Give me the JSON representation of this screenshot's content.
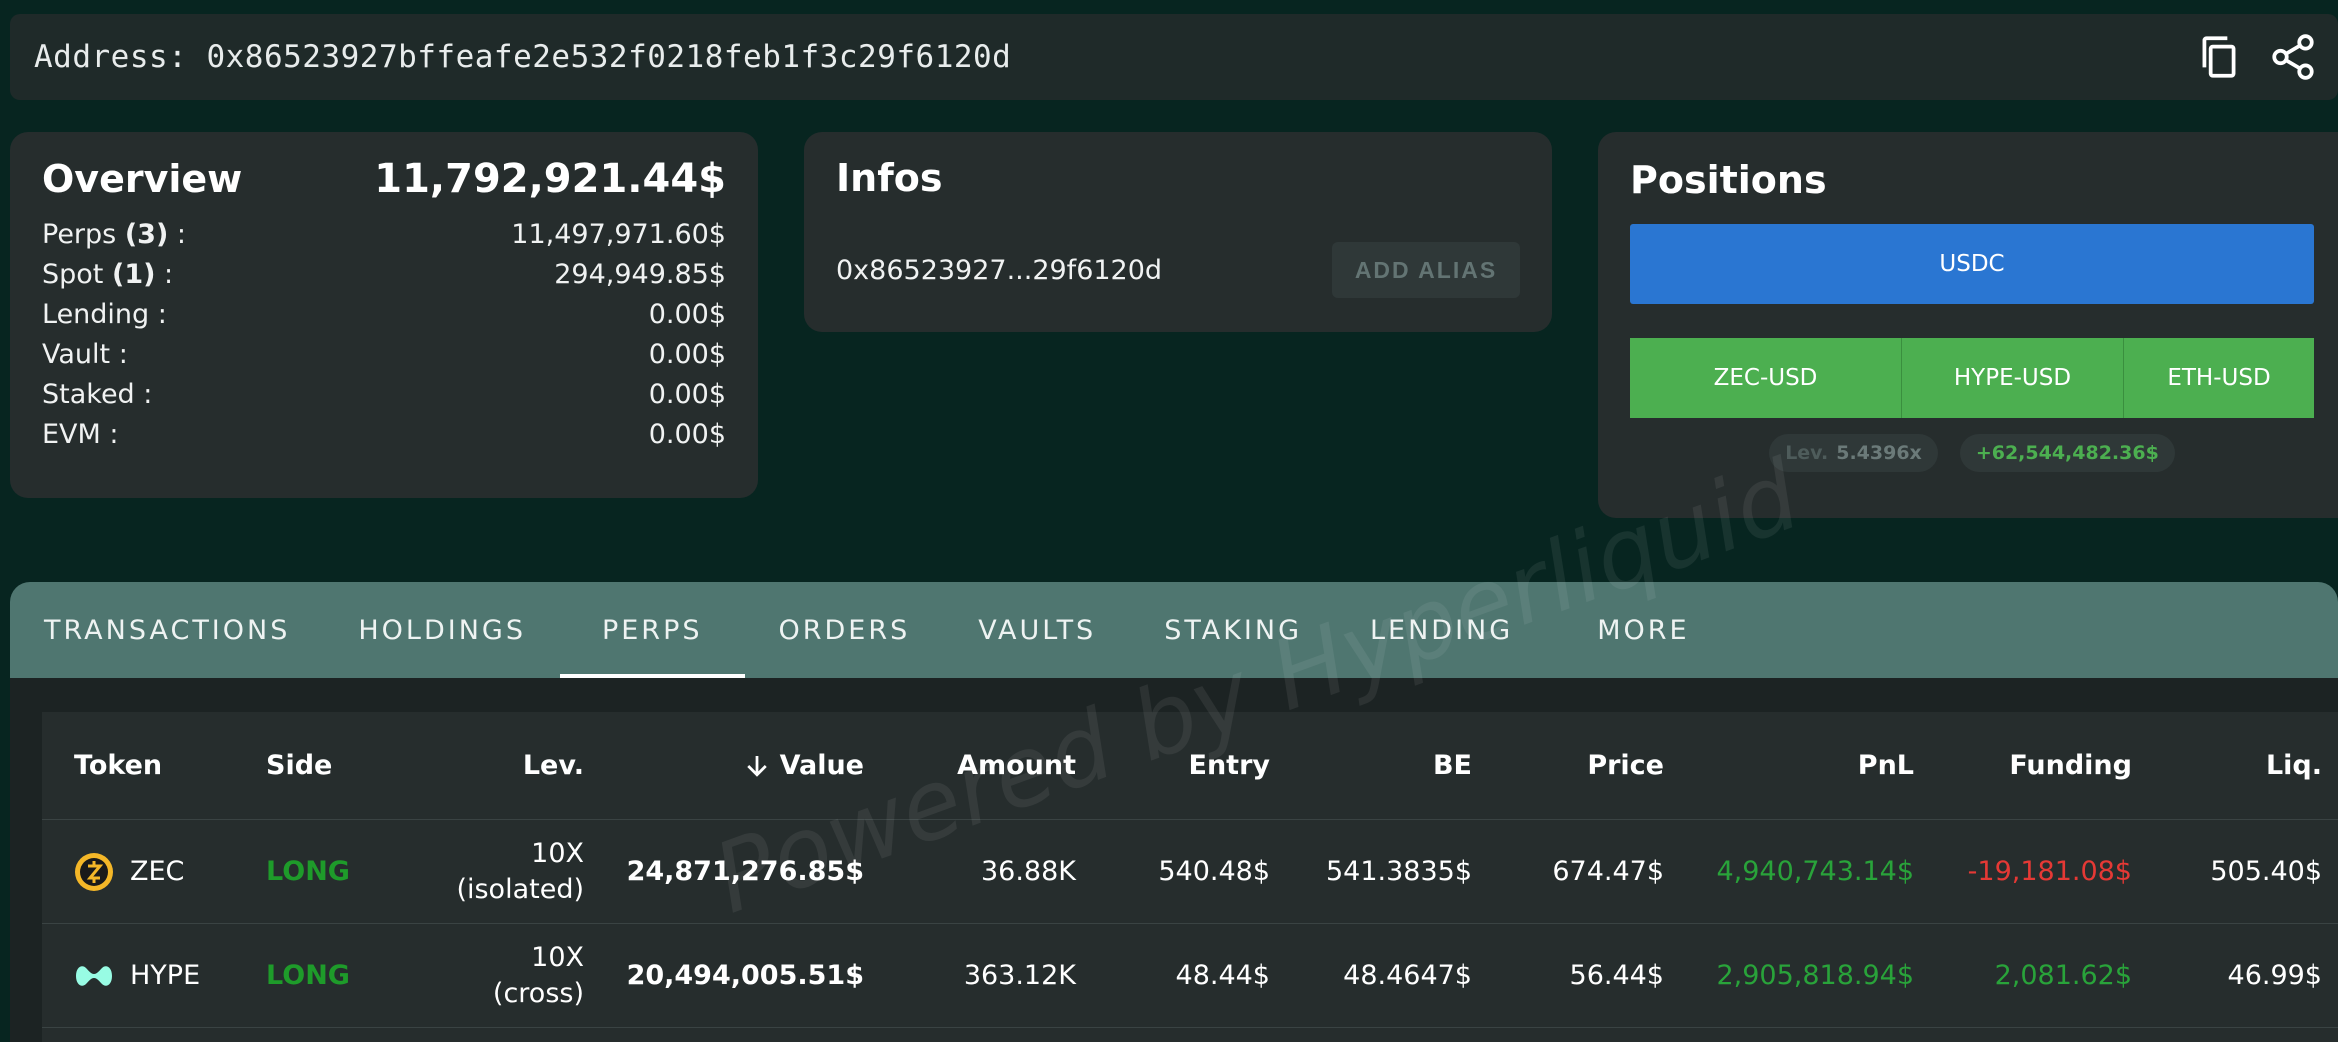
{
  "address_bar": {
    "label": "Address: 0x86523927bffeafe2e532f0218feb1f3c29f6120d",
    "icons": [
      "copy-icon",
      "share-icon"
    ]
  },
  "overview": {
    "title": "Overview",
    "total": "11,792,921.44$",
    "rows": [
      {
        "label": "Perps",
        "count": "(3)",
        "suffix": " :",
        "value": "11,497,971.60$"
      },
      {
        "label": "Spot",
        "count": "(1)",
        "suffix": " :",
        "value": "294,949.85$"
      },
      {
        "label": "Lending :",
        "value": "0.00$"
      },
      {
        "label": "Vault :",
        "value": "0.00$"
      },
      {
        "label": "Staked :",
        "value": "0.00$"
      },
      {
        "label": "EVM :",
        "value": "0.00$"
      }
    ]
  },
  "infos": {
    "title": "Infos",
    "short_address": "0x86523927...29f6120d",
    "alias_button": "ADD ALIAS"
  },
  "positions": {
    "title": "Positions",
    "collateral": "USDC",
    "markets": [
      "ZEC-USD",
      "HYPE-USD",
      "ETH-USD"
    ],
    "lev_label": "Lev.",
    "lev_value": "5.4396x",
    "pnl": "+62,544,482.36$",
    "colors": {
      "usdc": "#2a76d2",
      "market": "#4caf50"
    }
  },
  "tabs": [
    "TRANSACTIONS",
    "HOLDINGS",
    "PERPS",
    "ORDERS",
    "VAULTS",
    "STAKING",
    "LENDING",
    "MORE"
  ],
  "active_tab": "PERPS",
  "table": {
    "headers": {
      "token": "Token",
      "side": "Side",
      "lev": "Lev.",
      "value": "Value",
      "amount": "Amount",
      "entry": "Entry",
      "be": "BE",
      "price": "Price",
      "pnl": "PnL",
      "funding": "Funding",
      "liq": "Liq."
    },
    "sort_icon": "arrow-down-icon",
    "rows": [
      {
        "token": "ZEC",
        "icon": "zec-coin-icon",
        "side": "LONG",
        "lev": "10X",
        "margin": "(isolated)",
        "value": "24,871,276.85$",
        "amount": "36.88K",
        "entry": "540.48$",
        "be": "541.3835$",
        "price": "674.47$",
        "pnl": "4,940,743.14$",
        "funding": "-19,181.08$",
        "liq": "505.40$"
      },
      {
        "token": "HYPE",
        "icon": "hype-coin-icon",
        "side": "LONG",
        "lev": "10X",
        "margin": "(cross)",
        "value": "20,494,005.51$",
        "amount": "363.12K",
        "entry": "48.44$",
        "be": "48.4647$",
        "price": "56.44$",
        "pnl": "2,905,818.94$",
        "funding": "2,081.62$",
        "liq": "46.99$"
      }
    ]
  },
  "watermark": "Powered by Hyperliquid"
}
